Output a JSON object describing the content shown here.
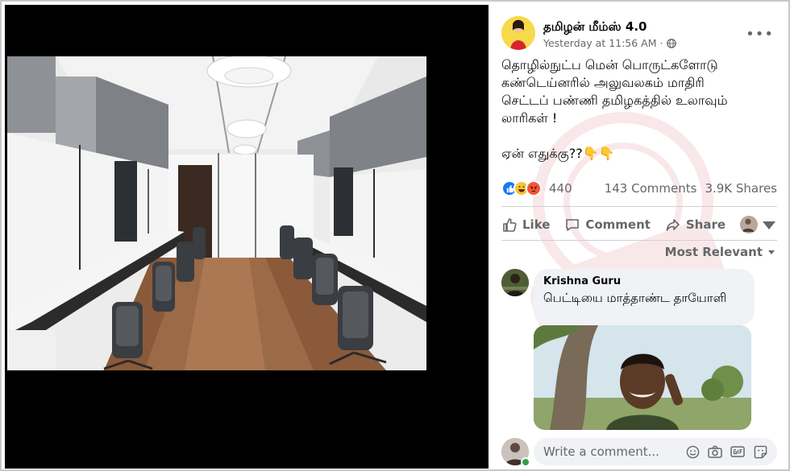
{
  "post": {
    "page_name": "தமிழன் மீம்ஸ் 4.0",
    "timestamp": "Yesterday at 11:56 AM",
    "privacy_separator": "·",
    "more_label": "•••",
    "text_lines": [
      "தொழில்நுட்ப மென் பொருட்களோடு",
      "கண்டெய்னரில் அலுவலகம் மாதிரி",
      "செட்டப் பண்ணி தமிழகத்தில் உலாவும்",
      "லாரிகள் !"
    ],
    "text_question": "ஏன் எதுக்கு??👇👇"
  },
  "engagement": {
    "reaction_count": "440",
    "comments": "143 Comments",
    "shares": "3.9K Shares",
    "reaction_icons": [
      "like-icon",
      "haha-icon",
      "angry-icon"
    ]
  },
  "actions": {
    "like": "Like",
    "comment": "Comment",
    "share": "Share"
  },
  "comments_section": {
    "sort_label": "Most Relevant",
    "comment": {
      "author": "Krishna Guru",
      "text": "பெட்டியை மாத்தாண்ட தாயோளி"
    },
    "write_placeholder": "Write a comment..."
  },
  "colors": {
    "accent": "#1877f2",
    "secondary_text": "#65676b",
    "bubble_bg": "#f0f2f5",
    "viewer_bg": "#000000",
    "online": "#31a24c"
  }
}
